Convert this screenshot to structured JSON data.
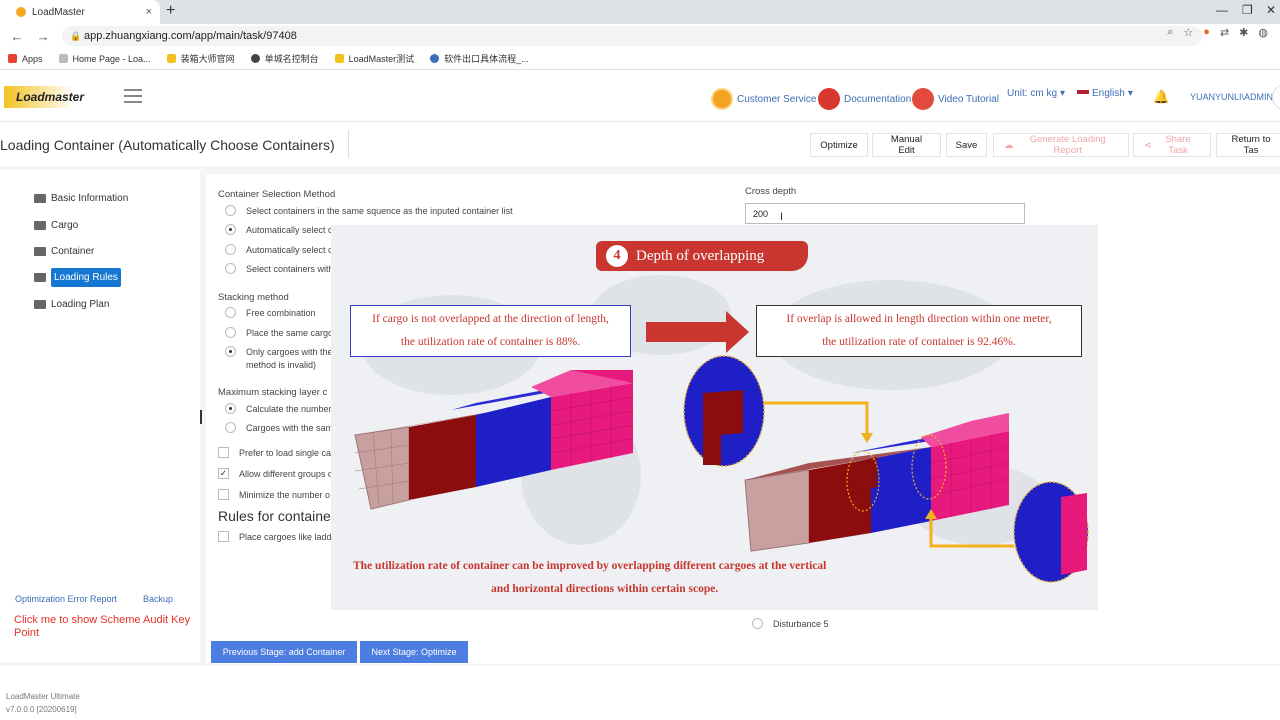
{
  "browser": {
    "tab_title": "LoadMaster",
    "close_glyph": "×",
    "new_tab_glyph": "+",
    "url": "app.zhuangxiang.com/app/main/task/97408",
    "bookmarks": [
      "Apps",
      "Home Page - Loa...",
      "装箱大师官网",
      "单城名控制台",
      "LoadMaster测试",
      "软件出口具体流程_..."
    ]
  },
  "header": {
    "logo_text": "Loadmaster",
    "customer_service": "Customer Service",
    "documentation": "Documentation",
    "video_tutorial": "Video Tutorial",
    "unit": "Unit: cm kg",
    "language": "English",
    "user": "YUANYUNLI\\ADMIN",
    "dropdown_glyph": "▾"
  },
  "titlebar": {
    "title": "Loading Container (Automatically Choose Containers)",
    "optimize": "Optimize",
    "manual_edit": "Manual Edit",
    "save": "Save",
    "generate_report": "Generate Loading Report",
    "share_task": "Share Task",
    "return_to_task": "Return to Tas"
  },
  "sidebar": {
    "items": [
      "Basic Information",
      "Cargo",
      "Container",
      "Loading Rules",
      "Loading Plan"
    ],
    "active_index": 3,
    "optimization_error_report": "Optimization Error Report",
    "backup": "Backup",
    "audit_link": "Click me to show Scheme Audit Key Point"
  },
  "form": {
    "container_selection_label": "Container Selection Method",
    "container_options": [
      "Select containers in the same squence as the inputed container list",
      "Automatically select c",
      "Automatically select c",
      "Select containers with"
    ],
    "container_selected": 1,
    "stacking_label": "Stacking method",
    "stacking_options": [
      "Free combination",
      "Place the same cargo",
      "Only cargoes with the"
    ],
    "stacking_option3_line2": "method is invalid)",
    "stacking_selected": 2,
    "max_stack_label": "Maximum stacking layer c",
    "max_stack_options": [
      "Calculate the number",
      "Cargoes with the sam"
    ],
    "max_stack_selected": 0,
    "checkboxes": [
      {
        "label": "Prefer to load single ca",
        "checked": false
      },
      {
        "label": "Allow different groups o",
        "checked": true
      },
      {
        "label": "Minimize the number o",
        "checked": false
      }
    ],
    "check_glyph": "✓",
    "rules_for_container": "Rules for container",
    "ladder_checkbox": "Place cargoes like ladd",
    "cross_depth_label": "Cross depth",
    "cross_depth_value": "200",
    "disturbance": "Disturbance 5",
    "prev_stage": "Previous Stage: add Container",
    "next_stage": "Next Stage: Optimize"
  },
  "footer": {
    "product": "LoadMaster Ultimate",
    "version": "v7.0.0.0 [20200619]"
  },
  "overlay": {
    "step_number": "4",
    "banner": "Depth of overlapping",
    "left_box_line1": "If cargo is not overlapped at the direction of length,",
    "left_box_line2": "the utilization rate of container is 88%.",
    "right_box_line1": "If overlap is allowed in length direction within one meter,",
    "right_box_line2": "the utilization rate of container is 92.46%.",
    "bottom_line1": "The utilization rate of container can be improved by overlapping different cargoes at the vertical",
    "bottom_line2": "and horizontal directions within certain scope."
  },
  "colors": {
    "accent_blue": "#1677d2",
    "stage_button": "#4d7de0",
    "link_blue": "#3c6fb6",
    "audit_red": "#e6332a",
    "overlay_red": "#c8362f",
    "cargo_pink": "#e8197d",
    "cargo_blue": "#1f1fc8",
    "cargo_darkred": "#8b0d0d",
    "cargo_tan": "#c9a0a0",
    "highlight_yellow": "#f2b01e"
  }
}
